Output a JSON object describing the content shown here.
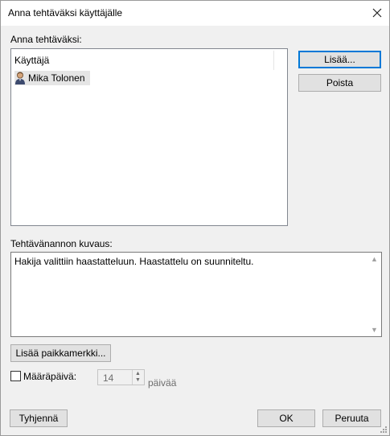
{
  "window": {
    "title": "Anna tehtäväksi käyttäjälle"
  },
  "assign_section": {
    "label": "Anna tehtäväksi:"
  },
  "user_list": {
    "column_header": "Käyttäjä",
    "rows": [
      {
        "name": "Mika Tolonen",
        "icon": "user-icon"
      }
    ]
  },
  "buttons": {
    "add": "Lisää...",
    "remove": "Poista",
    "insert_placeholder": "Lisää paikkamerkki...",
    "clear": "Tyhjennä",
    "ok": "OK",
    "cancel": "Peruuta"
  },
  "description": {
    "label": "Tehtävänannon kuvaus:",
    "value": "Hakija valittiin haastatteluun. Haastattelu on suunniteltu."
  },
  "due_date": {
    "label": "Määräpäivä:",
    "checked": false,
    "value": "14",
    "unit": "päivää"
  }
}
